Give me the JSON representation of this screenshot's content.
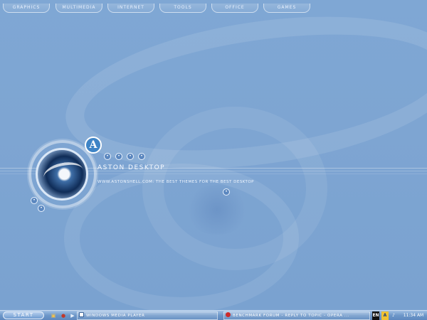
{
  "menu": {
    "tabs": [
      "GRAPHICS",
      "MULTIMEDIA",
      "INTERNET",
      "TOOLS",
      "OFFICE",
      "GAMES"
    ]
  },
  "desktop": {
    "title": "ASTON DESKTOP",
    "tagline": "WWW.ASTONSHELL.COM: THE BEST THEMES FOR THE BEST DESKTOP",
    "logo_letter": "A",
    "accent_color": "#3e84c6",
    "background_color": "#7ea5d2"
  },
  "taskbar": {
    "start_label": "START",
    "tasks": [
      {
        "label": "WINDOWS MEDIA PLAYER",
        "icon": "media-player-icon"
      },
      {
        "label": "BENCHMARK FORUM - REPLY TO TOPIC - OPERA ...",
        "icon": "opera-icon"
      }
    ],
    "tray": {
      "language": "EN",
      "clock": "11:34 AM"
    }
  }
}
